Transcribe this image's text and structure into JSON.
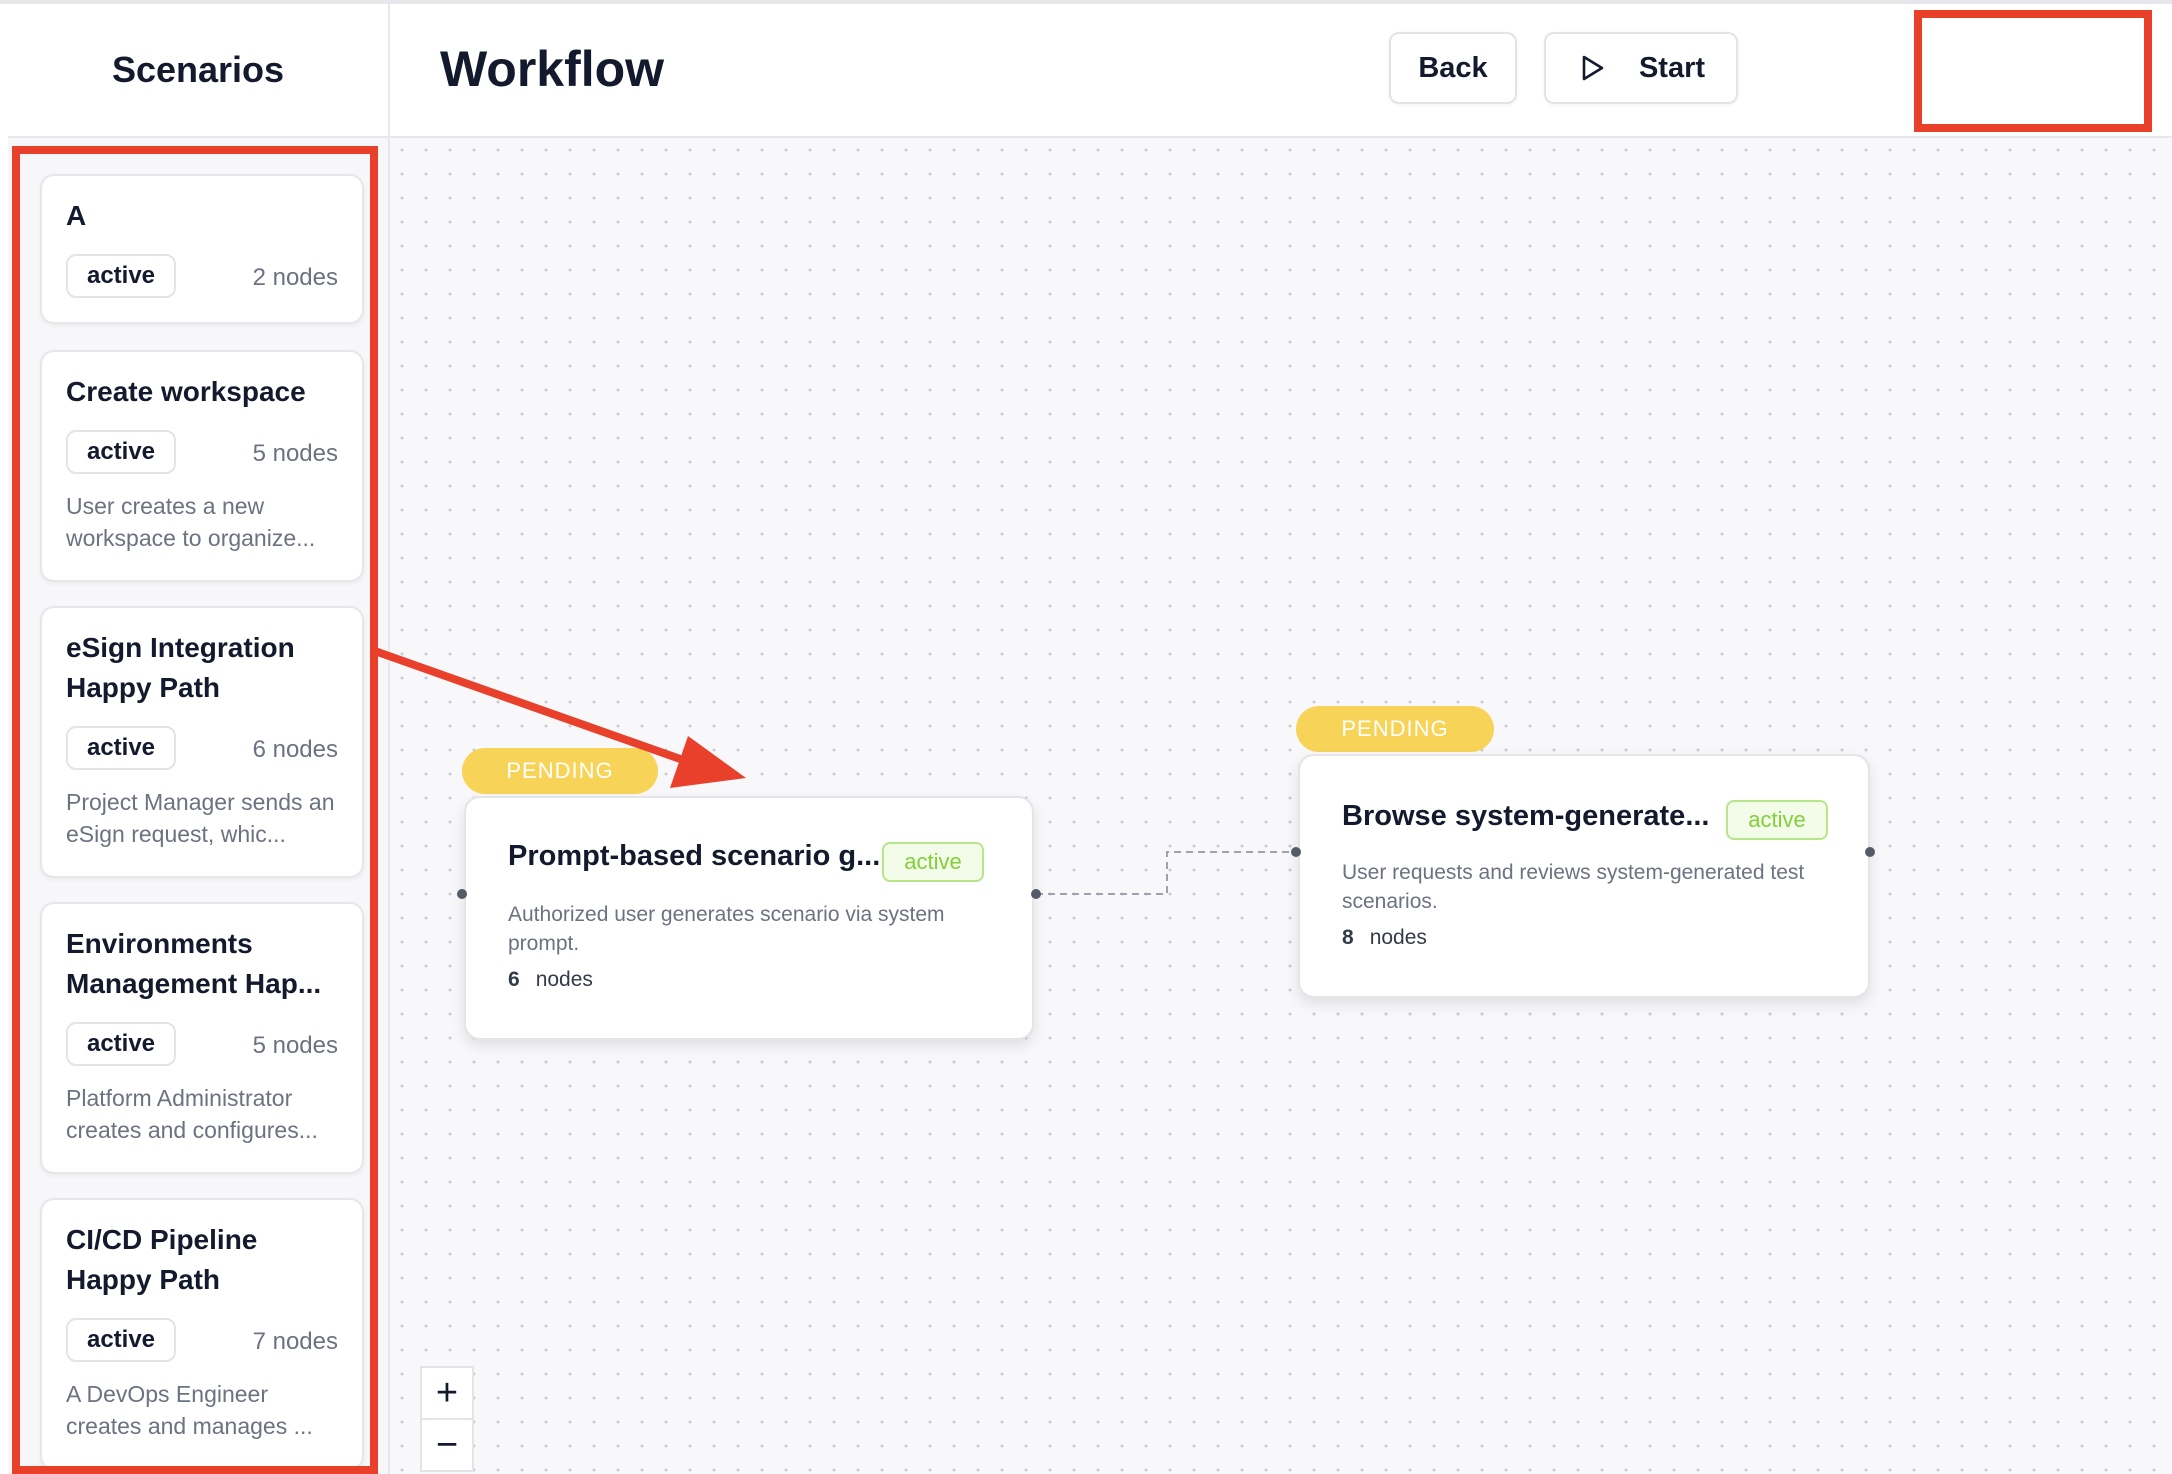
{
  "sidebar": {
    "title": "Scenarios",
    "scenarios": [
      {
        "title": "A",
        "status": "active",
        "nodes": "2 nodes",
        "description": ""
      },
      {
        "title": "Create workspace",
        "status": "active",
        "nodes": "5 nodes",
        "description": "User creates a new workspace to organize..."
      },
      {
        "title": "eSign Integration Happy Path",
        "status": "active",
        "nodes": "6 nodes",
        "description": "Project Manager sends an eSign request, whic..."
      },
      {
        "title": "Environments Management Hap...",
        "status": "active",
        "nodes": "5 nodes",
        "description": "Platform Administrator creates and configures..."
      },
      {
        "title": "CI/CD Pipeline Happy Path",
        "status": "active",
        "nodes": "7 nodes",
        "description": "A DevOps Engineer creates and manages ..."
      }
    ]
  },
  "header": {
    "title": "Workflow",
    "back_label": "Back",
    "start_label": "Start"
  },
  "canvas": {
    "nodes": [
      {
        "pending": "PENDING",
        "title": "Prompt-based scenario g...",
        "status": "active",
        "description": "Authorized user generates scenario via system prompt.",
        "count": "6",
        "count_label": "nodes"
      },
      {
        "pending": "PENDING",
        "title": "Browse system-generate...",
        "status": "active",
        "description": "User requests and reviews system-generated test scenarios.",
        "count": "8",
        "count_label": "nodes"
      }
    ],
    "zoom_in": "+",
    "zoom_out": "−"
  },
  "colors": {
    "annotation": "#e8402a",
    "pending": "#f7d358",
    "active_badge": "#82cf3a"
  }
}
